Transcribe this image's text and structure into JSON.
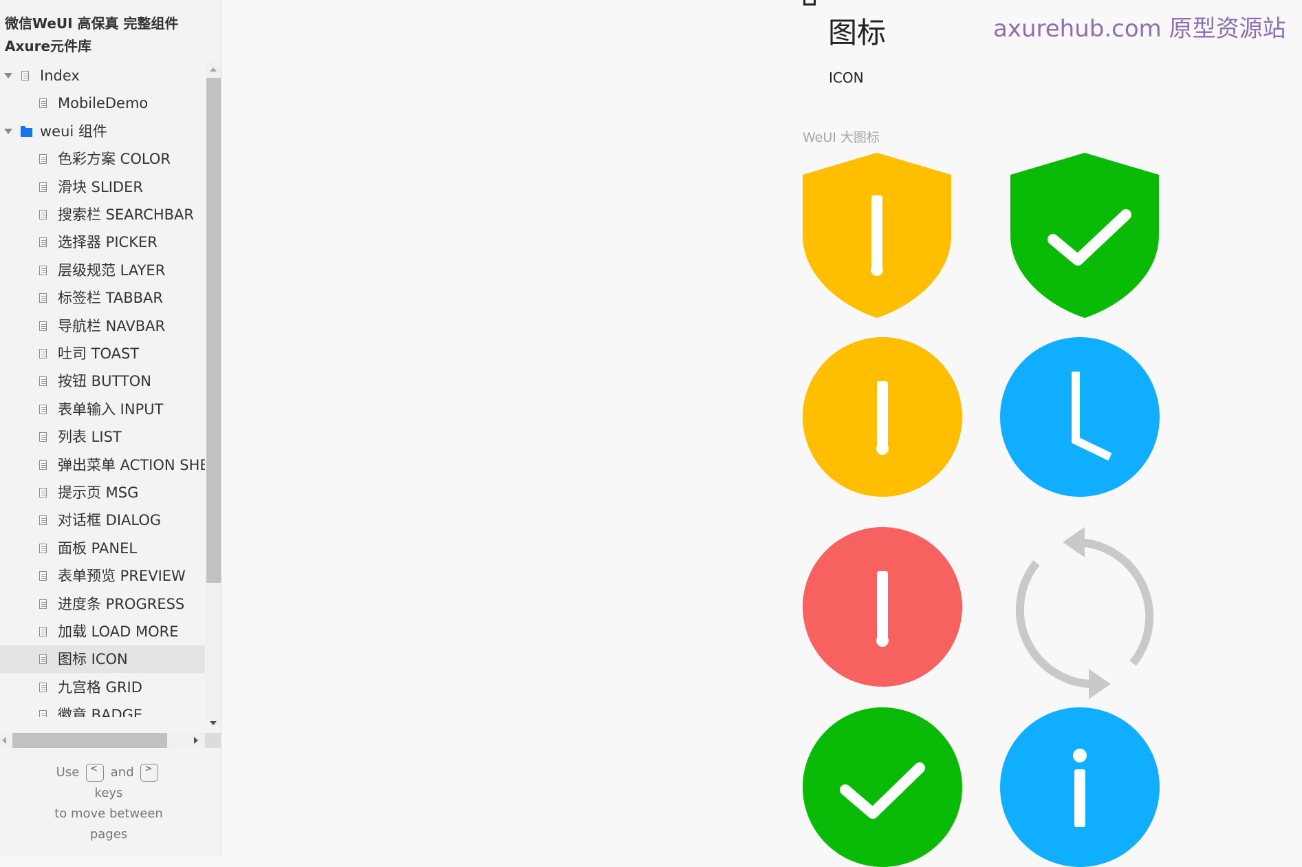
{
  "sidebar": {
    "project_title": "微信WeUI 高保真 完整组件 Axure元件库",
    "items": [
      {
        "label": "Index",
        "type": "page",
        "expanded": true,
        "level": 0
      },
      {
        "label": "MobileDemo",
        "type": "page",
        "level": 1
      },
      {
        "label": "weui 组件",
        "type": "folder",
        "expanded": true,
        "level": 0
      },
      {
        "label": "色彩方案 COLOR",
        "type": "page",
        "level": 1
      },
      {
        "label": "滑块 SLIDER",
        "type": "page",
        "level": 1
      },
      {
        "label": "搜索栏 SEARCHBAR",
        "type": "page",
        "level": 1
      },
      {
        "label": "选择器 PICKER",
        "type": "page",
        "level": 1
      },
      {
        "label": "层级规范 LAYER",
        "type": "page",
        "level": 1
      },
      {
        "label": "标签栏 TABBAR",
        "type": "page",
        "level": 1
      },
      {
        "label": "导航栏 NAVBAR",
        "type": "page",
        "level": 1
      },
      {
        "label": "吐司 TOAST",
        "type": "page",
        "level": 1
      },
      {
        "label": "按钮 BUTTON",
        "type": "page",
        "level": 1
      },
      {
        "label": "表单输入 INPUT",
        "type": "page",
        "level": 1
      },
      {
        "label": "列表 LIST",
        "type": "page",
        "level": 1
      },
      {
        "label": "弹出菜单 ACTION SHEET",
        "type": "page",
        "level": 1
      },
      {
        "label": "提示页 MSG",
        "type": "page",
        "level": 1
      },
      {
        "label": "对话框 DIALOG",
        "type": "page",
        "level": 1
      },
      {
        "label": "面板 PANEL",
        "type": "page",
        "level": 1
      },
      {
        "label": "表单预览 PREVIEW",
        "type": "page",
        "level": 1
      },
      {
        "label": "进度条 PROGRESS",
        "type": "page",
        "level": 1
      },
      {
        "label": "加载 LOAD MORE",
        "type": "page",
        "level": 1
      },
      {
        "label": "图标 ICON",
        "type": "page",
        "level": 1,
        "selected": true
      },
      {
        "label": "九宫格 GRID",
        "type": "page",
        "level": 1
      },
      {
        "label": "徽章 BADGE",
        "type": "page",
        "level": 1
      }
    ],
    "help": {
      "use": "Use",
      "left_key": "<",
      "and": "and",
      "right_key": ">",
      "keys": "keys",
      "line2": "to move between",
      "line3": "pages"
    }
  },
  "main": {
    "heading": "图标",
    "subheading": "ICON",
    "watermark": "axurehub.com 原型资源站",
    "section_label": "WeUI 大图标",
    "icons": [
      {
        "name": "warn-shield-icon",
        "color": "#FFBE00"
      },
      {
        "name": "safe-success-shield-icon",
        "color": "#09BB07"
      },
      {
        "name": "info-warn-circle-icon",
        "color": "#FFBE00"
      },
      {
        "name": "waiting-clock-icon",
        "color": "#10AEFF"
      },
      {
        "name": "error-warn-circle-icon",
        "color": "#F76260"
      },
      {
        "name": "refresh-icon",
        "color": "#C9C9C9"
      },
      {
        "name": "success-circle-icon",
        "color": "#09BB07"
      },
      {
        "name": "info-circle-icon",
        "color": "#10AEFF"
      }
    ]
  }
}
